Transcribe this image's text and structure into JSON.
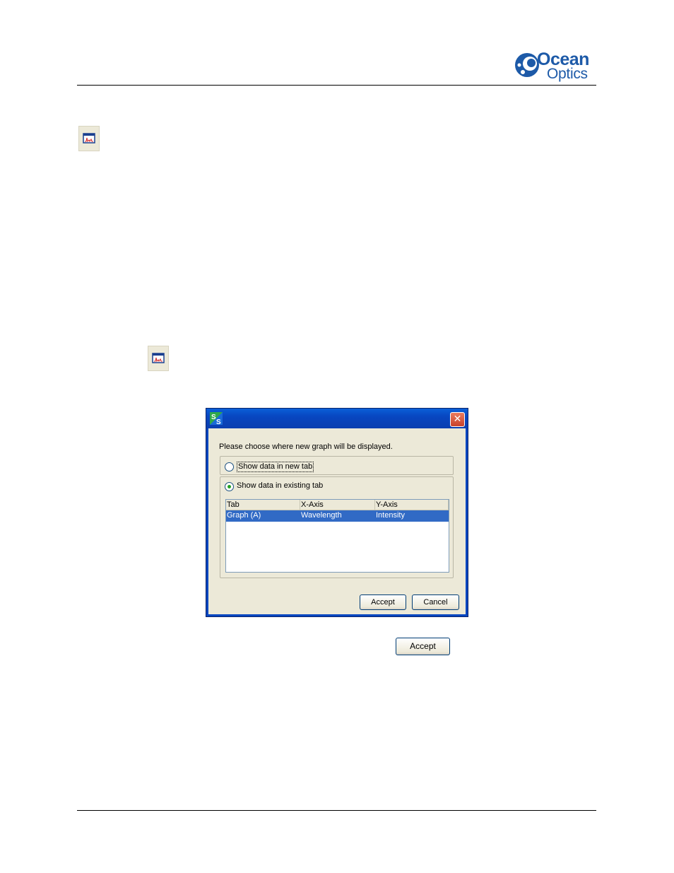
{
  "header": {
    "logo": {
      "line1": "Ocean",
      "line2": "Optics",
      "brand_color": "#1d5aa8"
    }
  },
  "icons": {
    "graph_icon": "graph-icon"
  },
  "dialog": {
    "title": "",
    "close_label": "✕",
    "prompt": "Please choose where new graph will be displayed.",
    "option_new_tab": "Show data in new tab",
    "option_existing_tab": "Show data in existing tab",
    "selected_option": "existing_tab",
    "table": {
      "headers": [
        "Tab",
        "X-Axis",
        "Y-Axis"
      ],
      "rows": [
        [
          "Graph (A)",
          "Wavelength",
          "Intensity"
        ]
      ],
      "selected_row": 0,
      "selection_color": "#316ac5"
    },
    "accept_label": "Accept",
    "cancel_label": "Cancel"
  },
  "inline_button": {
    "label": "Accept"
  }
}
